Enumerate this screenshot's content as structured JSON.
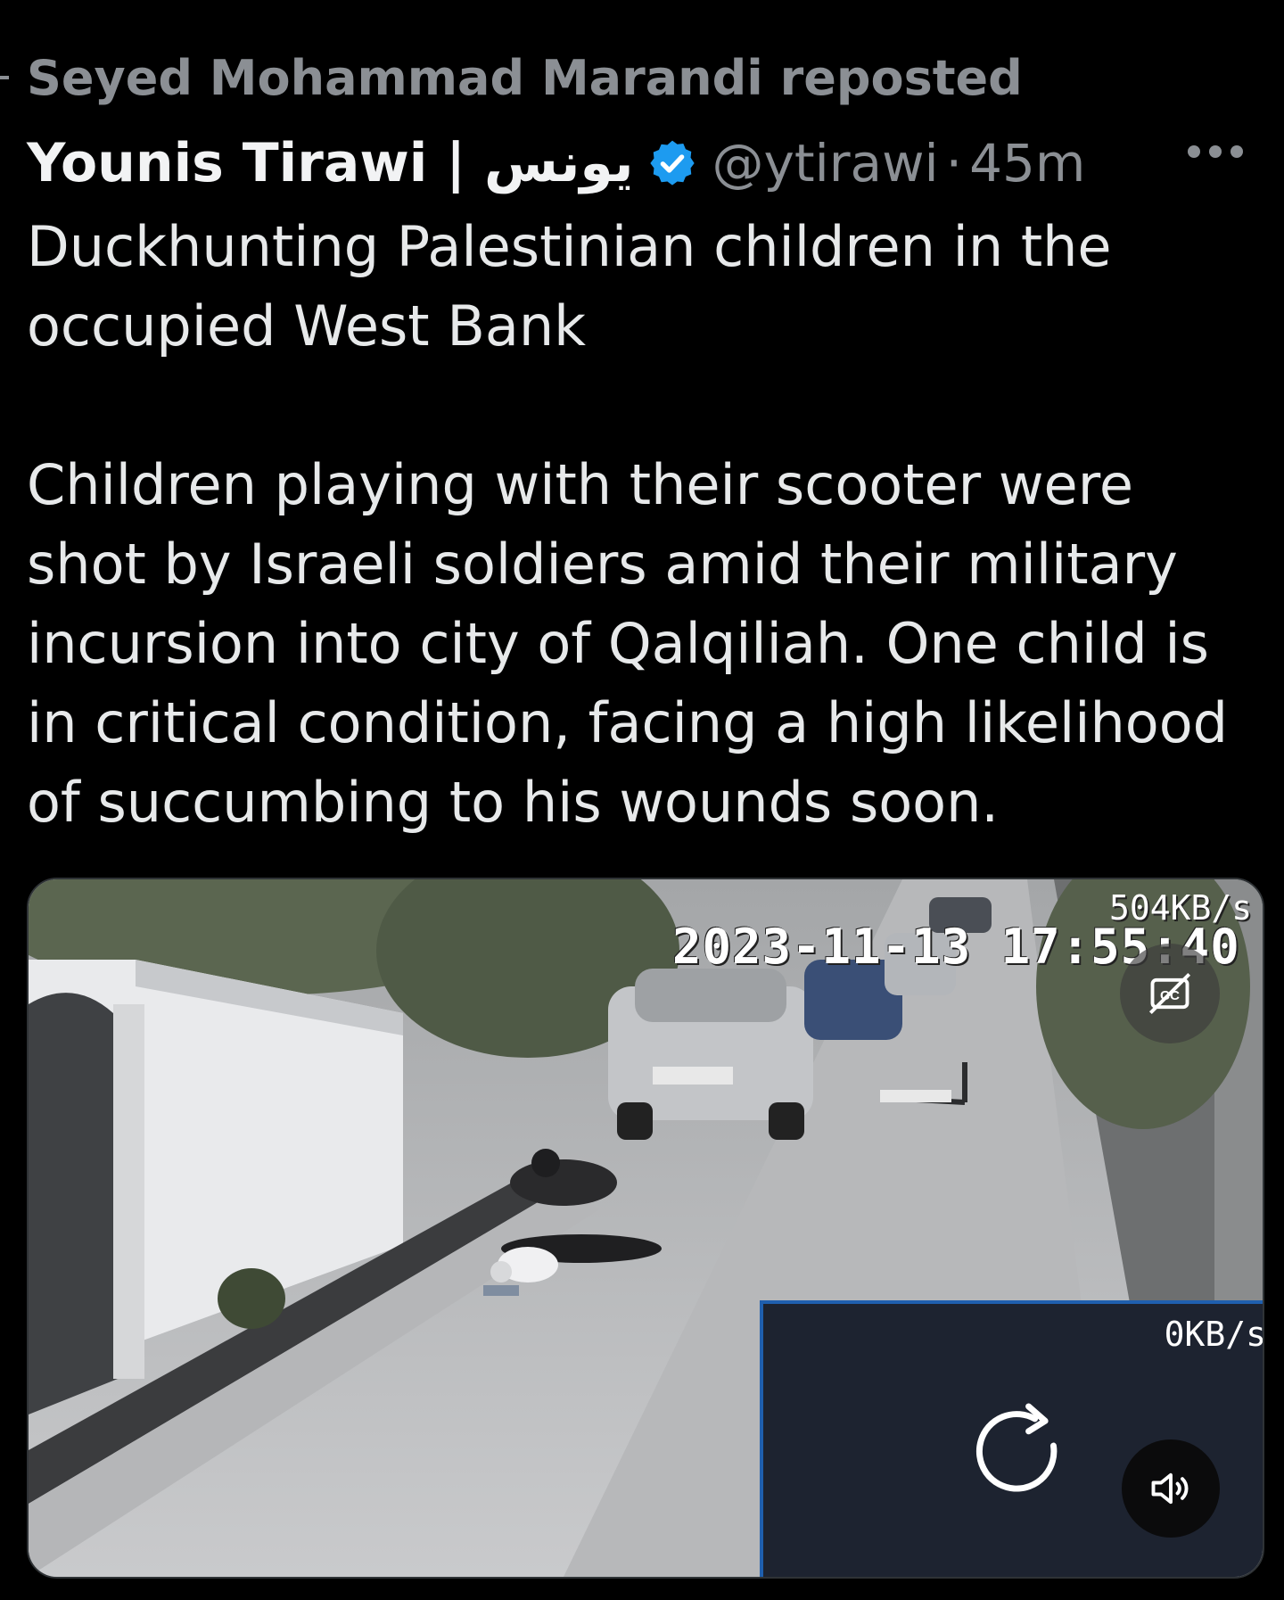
{
  "repost": {
    "text": "Seyed Mohammad Marandi reposted"
  },
  "author": {
    "name": "Younis Tirawi | يونس",
    "handle": "@ytirawi",
    "separator": "·",
    "time": "45m",
    "verified_icon": "verified-badge-icon",
    "verified_color": "#1d9bf0"
  },
  "tweet": {
    "paragraph1": "Duckhunting Palestinian children in the occupied West Bank",
    "paragraph2": "Children playing with their scooter were shot by Israeli soldiers amid their military incursion into city of Qalqiliah. One child is in critical condition, facing a high likelihood of succumbing to his wounds soon."
  },
  "media": {
    "timestamp": "2023-11-13 17:55:40",
    "rate_top": "504KB/s",
    "rate_inset": "0KB/s",
    "cc_icon": "closed-captions-icon",
    "reload_icon": "reload-icon",
    "sound_icon": "speaker-icon"
  },
  "more_icon": "more-options-icon"
}
